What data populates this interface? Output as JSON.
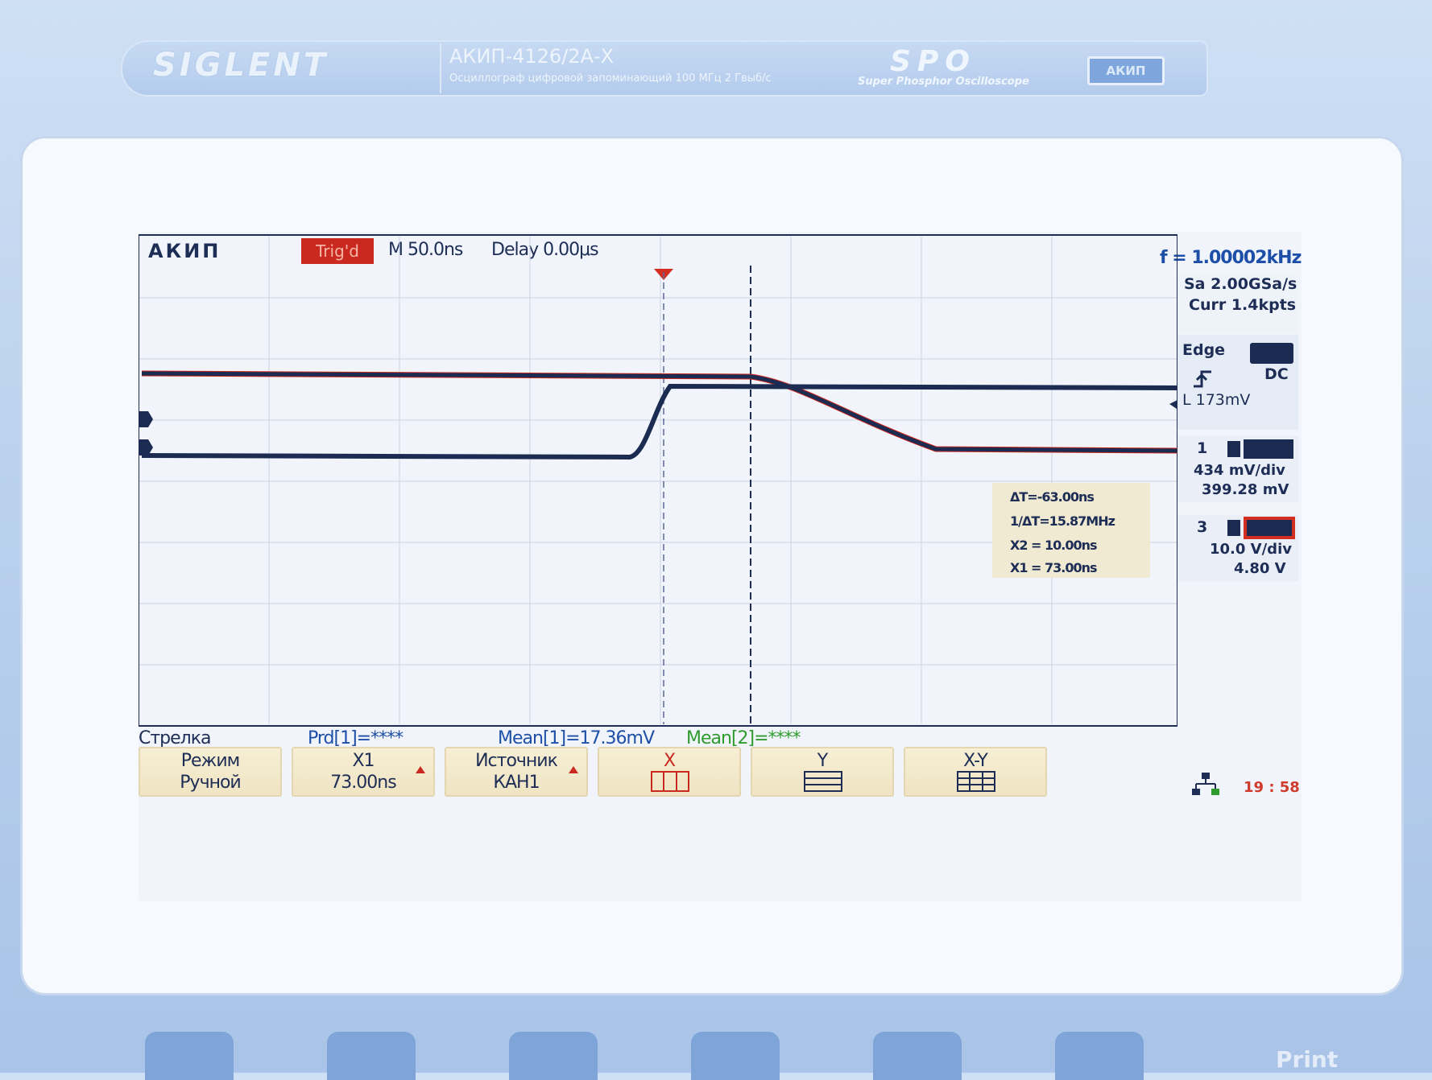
{
  "brand": {
    "logo": "SIGLENT",
    "model": "АКИП-4126/2А-X",
    "description": "Осциллограф цифровой запоминающий  100 МГц  2 Гвыб/с",
    "spo": "SPO",
    "spo_subtitle": "Super Phosphor Oscilloscope",
    "badge": "АКИП"
  },
  "status": {
    "vendor": "АКИП",
    "trigger_state": "Trig'd",
    "timebase": "M 50.0ns",
    "delay": "Delay 0.00μs",
    "frequency": "f = 1.00002kHz"
  },
  "acquisition": {
    "sample_rate": "Sa 2.00GSa/s",
    "memory": "Curr 1.4kpts"
  },
  "trigger": {
    "type": "Edge",
    "coupling": "DC",
    "level": "L  173mV"
  },
  "channels": [
    {
      "number": "1",
      "scale": "434  mV/div",
      "offset": "399.28  mV"
    },
    {
      "number": "3",
      "scale": "10.0  V/div",
      "offset": "4.80  V"
    }
  ],
  "cursors": {
    "delta_t": "ΔT=-63.00ns",
    "inv_delta_t": "1/ΔT=15.87MHz",
    "x2": "X2 = 10.00ns",
    "x1": "X1 = 73.00ns"
  },
  "measurements": {
    "menu_title": "Стрелка",
    "prd": "Prd[1]=****",
    "mean1": "Mean[1]=17.36mV",
    "mean2": "Mean[2]=****"
  },
  "softkeys": [
    {
      "line1": "Режим",
      "line2": "Ручной"
    },
    {
      "line1": "X1",
      "line2": "73.00ns"
    },
    {
      "line1": "Источник",
      "line2": "КАН1"
    },
    {
      "line1": "X",
      "line2": ""
    },
    {
      "line1": "Y",
      "line2": ""
    },
    {
      "line1": "X-Y",
      "line2": ""
    }
  ],
  "clock": "19 : 58",
  "print_label": "Print",
  "colors": {
    "trace": "#1b2b52",
    "trace_ch3_edge": "#c9291f",
    "trig_badge": "#c9291f",
    "mean2_text": "#2f9b2f",
    "prd_text": "#1d4fa8"
  }
}
